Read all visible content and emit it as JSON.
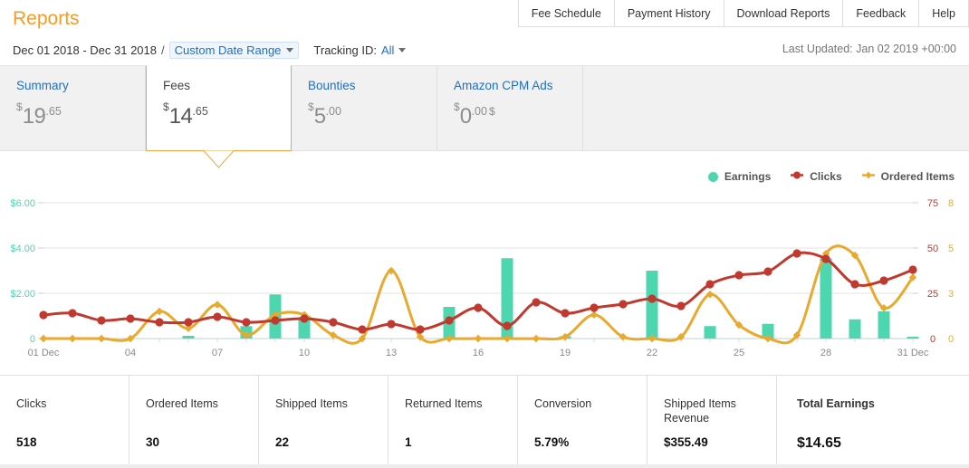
{
  "header": {
    "title": "Reports",
    "date_range": "Dec 01 2018 - Dec 31 2018",
    "separator": "/",
    "date_mode": "Custom Date Range",
    "tracking_label": "Tracking ID:",
    "tracking_value": "All",
    "last_updated": "Last Updated: Jan 02 2019 +00:00"
  },
  "topnav": {
    "items": [
      {
        "label": "Fee Schedule"
      },
      {
        "label": "Payment History"
      },
      {
        "label": "Download Reports"
      },
      {
        "label": "Feedback"
      },
      {
        "label": "Help"
      }
    ]
  },
  "tabs": [
    {
      "label": "Summary",
      "currency": "$",
      "whole": "19",
      "cents": ".65",
      "trail": "",
      "selected": false
    },
    {
      "label": "Fees",
      "currency": "$",
      "whole": "14",
      "cents": ".65",
      "trail": "",
      "selected": true
    },
    {
      "label": "Bounties",
      "currency": "$",
      "whole": "5",
      "cents": ".00",
      "trail": "",
      "selected": false
    },
    {
      "label": "Amazon CPM Ads",
      "currency": "$",
      "whole": "0",
      "cents": ".00",
      "trail": "$",
      "selected": false
    }
  ],
  "legend": [
    {
      "label": "Earnings",
      "color": "#4ED6AF",
      "marker": "circle-marker"
    },
    {
      "label": "Clicks",
      "color": "#C0392F",
      "marker": "diamond-marker"
    },
    {
      "label": "Ordered Items",
      "color": "#E8A92D",
      "marker": "diamond-marker"
    }
  ],
  "metrics": [
    {
      "name": "clicks",
      "head": "Clicks",
      "value": "518"
    },
    {
      "name": "ordered-items",
      "head": "Ordered Items",
      "value": "30"
    },
    {
      "name": "shipped-items",
      "head": "Shipped Items",
      "value": "22"
    },
    {
      "name": "returned-items",
      "head": "Returned Items",
      "value": "1"
    },
    {
      "name": "conversion",
      "head": "Conversion",
      "value": "5.79%"
    },
    {
      "name": "shipped-revenue",
      "head": "Shipped Items Revenue",
      "value": "$355.49"
    },
    {
      "name": "total-earnings",
      "head": "Total Earnings",
      "value": "$14.65"
    }
  ],
  "chart_data": {
    "type": "line",
    "title": "",
    "xlabel": "",
    "grid": true,
    "legend_position": "top-right",
    "x": [
      "01 Dec",
      "02",
      "03",
      "04",
      "05",
      "06",
      "07",
      "08",
      "09",
      "10",
      "11",
      "12",
      "13",
      "14",
      "15",
      "16",
      "17",
      "18",
      "19",
      "20",
      "21",
      "22",
      "23",
      "24",
      "25",
      "26",
      "27",
      "28",
      "29",
      "30",
      "31 Dec"
    ],
    "xtick_labels": [
      "01 Dec",
      "04",
      "07",
      "10",
      "13",
      "16",
      "19",
      "22",
      "25",
      "28",
      "31 Dec"
    ],
    "axes": [
      {
        "name": "earnings-axis",
        "side": "left",
        "color": "#4ED6AF",
        "ticks": [
          "0",
          "$2.00",
          "$4.00",
          "$6.00"
        ],
        "lim": [
          0,
          6
        ]
      },
      {
        "name": "clicks-axis",
        "side": "right",
        "color": "#C0392F",
        "ticks": [
          "0",
          "25",
          "50",
          "75"
        ],
        "lim": [
          0,
          75
        ]
      },
      {
        "name": "ordered-axis",
        "side": "right",
        "color": "#E8A92D",
        "ticks": [
          "0",
          "3",
          "5",
          "8"
        ],
        "lim": [
          0,
          8
        ]
      }
    ],
    "series": [
      {
        "name": "Earnings",
        "type": "bar",
        "color": "#4ED6AF",
        "axis": "earnings-axis",
        "values": [
          0,
          0,
          0,
          0,
          0,
          0.12,
          0,
          0.55,
          1.95,
          0.95,
          0,
          0,
          0,
          0,
          1.4,
          0,
          3.55,
          0,
          0.1,
          0,
          0,
          3.0,
          0,
          0.55,
          0,
          0.65,
          0,
          3.55,
          0.85,
          1.2,
          0.08
        ]
      },
      {
        "name": "Clicks",
        "type": "line",
        "color": "#C0392F",
        "axis": "clicks-axis",
        "values": [
          13,
          14,
          10,
          11,
          9,
          9,
          12,
          9,
          10,
          11,
          9,
          5,
          8,
          5,
          10,
          17,
          7,
          20,
          14,
          17,
          19,
          22,
          18,
          30,
          35,
          37,
          47,
          44,
          30,
          32,
          38
        ]
      },
      {
        "name": "Ordered Items",
        "type": "line",
        "color": "#E8A92D",
        "axis": "ordered-axis",
        "values": [
          0,
          0,
          0,
          0,
          1.6,
          0.6,
          2.0,
          0.2,
          1.4,
          1.4,
          0.2,
          0,
          4.0,
          0.1,
          0,
          0,
          0,
          0,
          0.1,
          1.4,
          0.1,
          0,
          0.1,
          2.6,
          0.8,
          0,
          0.2,
          5.0,
          4.9,
          1.8,
          3.6
        ]
      }
    ]
  }
}
